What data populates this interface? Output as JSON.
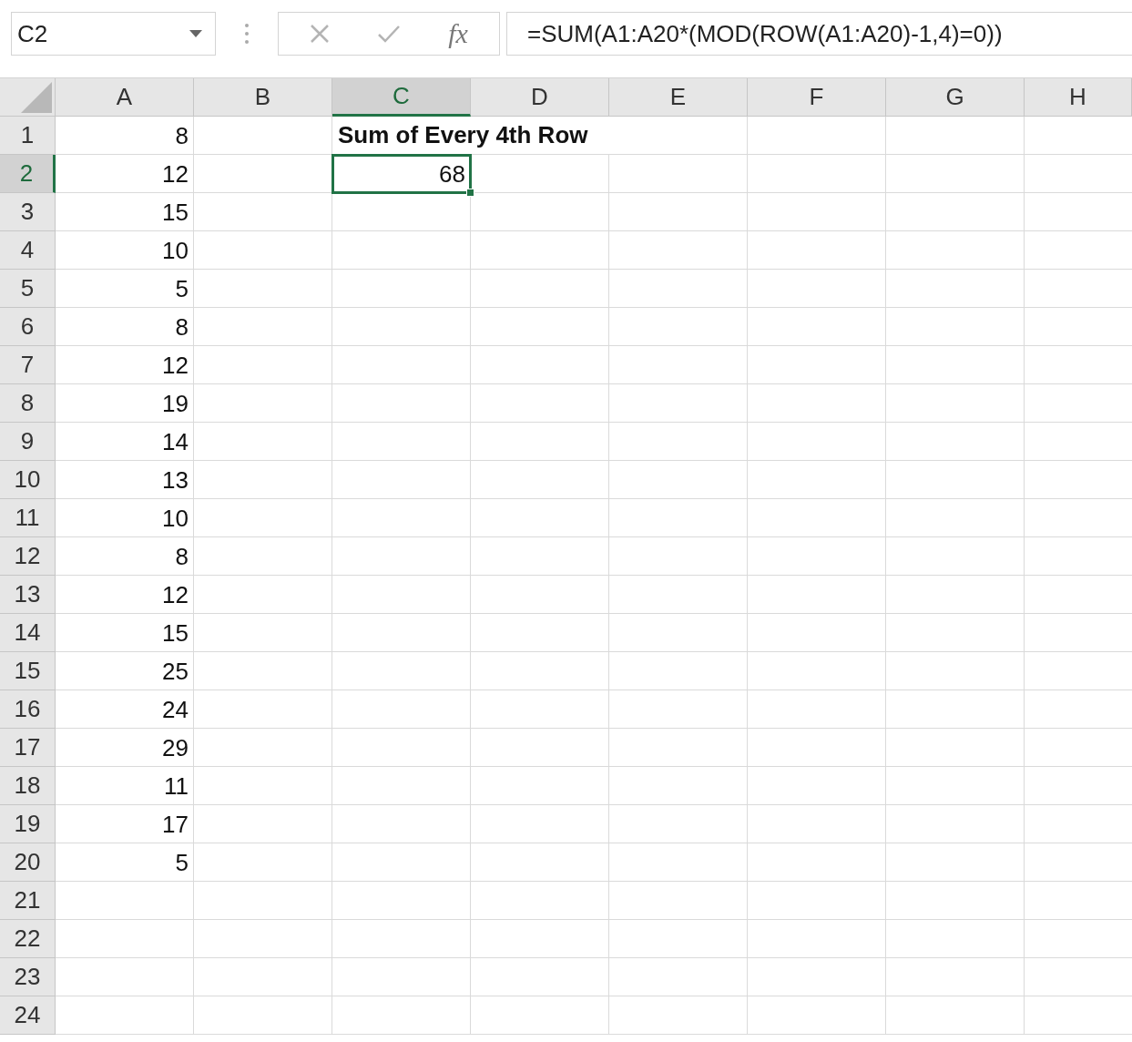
{
  "formula_bar": {
    "name_box": "C2",
    "fx": "fx",
    "formula": "=SUM(A1:A20*(MOD(ROW(A1:A20)-1,4)=0))"
  },
  "columns": [
    {
      "label": "A",
      "selected": false
    },
    {
      "label": "B",
      "selected": false
    },
    {
      "label": "C",
      "selected": true
    },
    {
      "label": "D",
      "selected": false
    },
    {
      "label": "E",
      "selected": false
    },
    {
      "label": "F",
      "selected": false
    },
    {
      "label": "G",
      "selected": false
    },
    {
      "label": "H",
      "selected": false
    }
  ],
  "rows": [
    {
      "label": "1",
      "selected": false,
      "col_a": {
        "value": "8"
      },
      "col_c": {
        "value": "Sum of Every 4th Row",
        "kind": "heading",
        "selected": false
      }
    },
    {
      "label": "2",
      "selected": true,
      "col_a": {
        "value": "12"
      },
      "col_c": {
        "value": "68",
        "kind": "number",
        "selected": true
      }
    },
    {
      "label": "3",
      "selected": false,
      "col_a": {
        "value": "15"
      }
    },
    {
      "label": "4",
      "selected": false,
      "col_a": {
        "value": "10"
      }
    },
    {
      "label": "5",
      "selected": false,
      "col_a": {
        "value": "5"
      }
    },
    {
      "label": "6",
      "selected": false,
      "col_a": {
        "value": "8"
      }
    },
    {
      "label": "7",
      "selected": false,
      "col_a": {
        "value": "12"
      }
    },
    {
      "label": "8",
      "selected": false,
      "col_a": {
        "value": "19"
      }
    },
    {
      "label": "9",
      "selected": false,
      "col_a": {
        "value": "14"
      }
    },
    {
      "label": "10",
      "selected": false,
      "col_a": {
        "value": "13"
      }
    },
    {
      "label": "11",
      "selected": false,
      "col_a": {
        "value": "10"
      }
    },
    {
      "label": "12",
      "selected": false,
      "col_a": {
        "value": "8"
      }
    },
    {
      "label": "13",
      "selected": false,
      "col_a": {
        "value": "12"
      }
    },
    {
      "label": "14",
      "selected": false,
      "col_a": {
        "value": "15"
      }
    },
    {
      "label": "15",
      "selected": false,
      "col_a": {
        "value": "25"
      }
    },
    {
      "label": "16",
      "selected": false,
      "col_a": {
        "value": "24"
      }
    },
    {
      "label": "17",
      "selected": false,
      "col_a": {
        "value": "29"
      }
    },
    {
      "label": "18",
      "selected": false,
      "col_a": {
        "value": "11"
      }
    },
    {
      "label": "19",
      "selected": false,
      "col_a": {
        "value": "17"
      }
    },
    {
      "label": "20",
      "selected": false,
      "col_a": {
        "value": "5"
      }
    },
    {
      "label": "21",
      "selected": false
    },
    {
      "label": "22",
      "selected": false
    },
    {
      "label": "23",
      "selected": false
    },
    {
      "label": "24",
      "selected": false
    }
  ]
}
